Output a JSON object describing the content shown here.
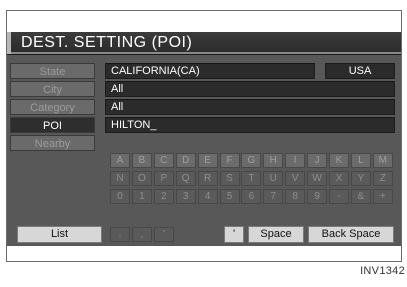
{
  "screen": {
    "title": "DEST. SETTING (POI)"
  },
  "fields": {
    "state_label": "State",
    "state_value": "CALIFORNIA(CA)",
    "country_value": "USA",
    "city_label": "City",
    "city_value": "All",
    "category_label": "Category",
    "category_value": "All",
    "poi_label": "POI",
    "poi_value": "HILTON_",
    "nearby_label": "Nearby"
  },
  "keyboard": {
    "row1": [
      "A",
      "B",
      "C",
      "D",
      "E",
      "F",
      "G",
      "H",
      "I",
      "J",
      "K",
      "L",
      "M"
    ],
    "row2": [
      "N",
      "O",
      "P",
      "Q",
      "R",
      "S",
      "T",
      "U",
      "V",
      "W",
      "X",
      "Y",
      "Z"
    ],
    "row3": [
      "0",
      "1",
      "2",
      "3",
      "4",
      "5",
      "6",
      "7",
      "8",
      "9",
      "-",
      "&",
      "+"
    ],
    "row4": [
      ".",
      ",",
      "'"
    ]
  },
  "buttons": {
    "list": "List",
    "apostrophe": "'",
    "space": "Space",
    "back_space": "Back Space"
  },
  "caption": "INV1342"
}
